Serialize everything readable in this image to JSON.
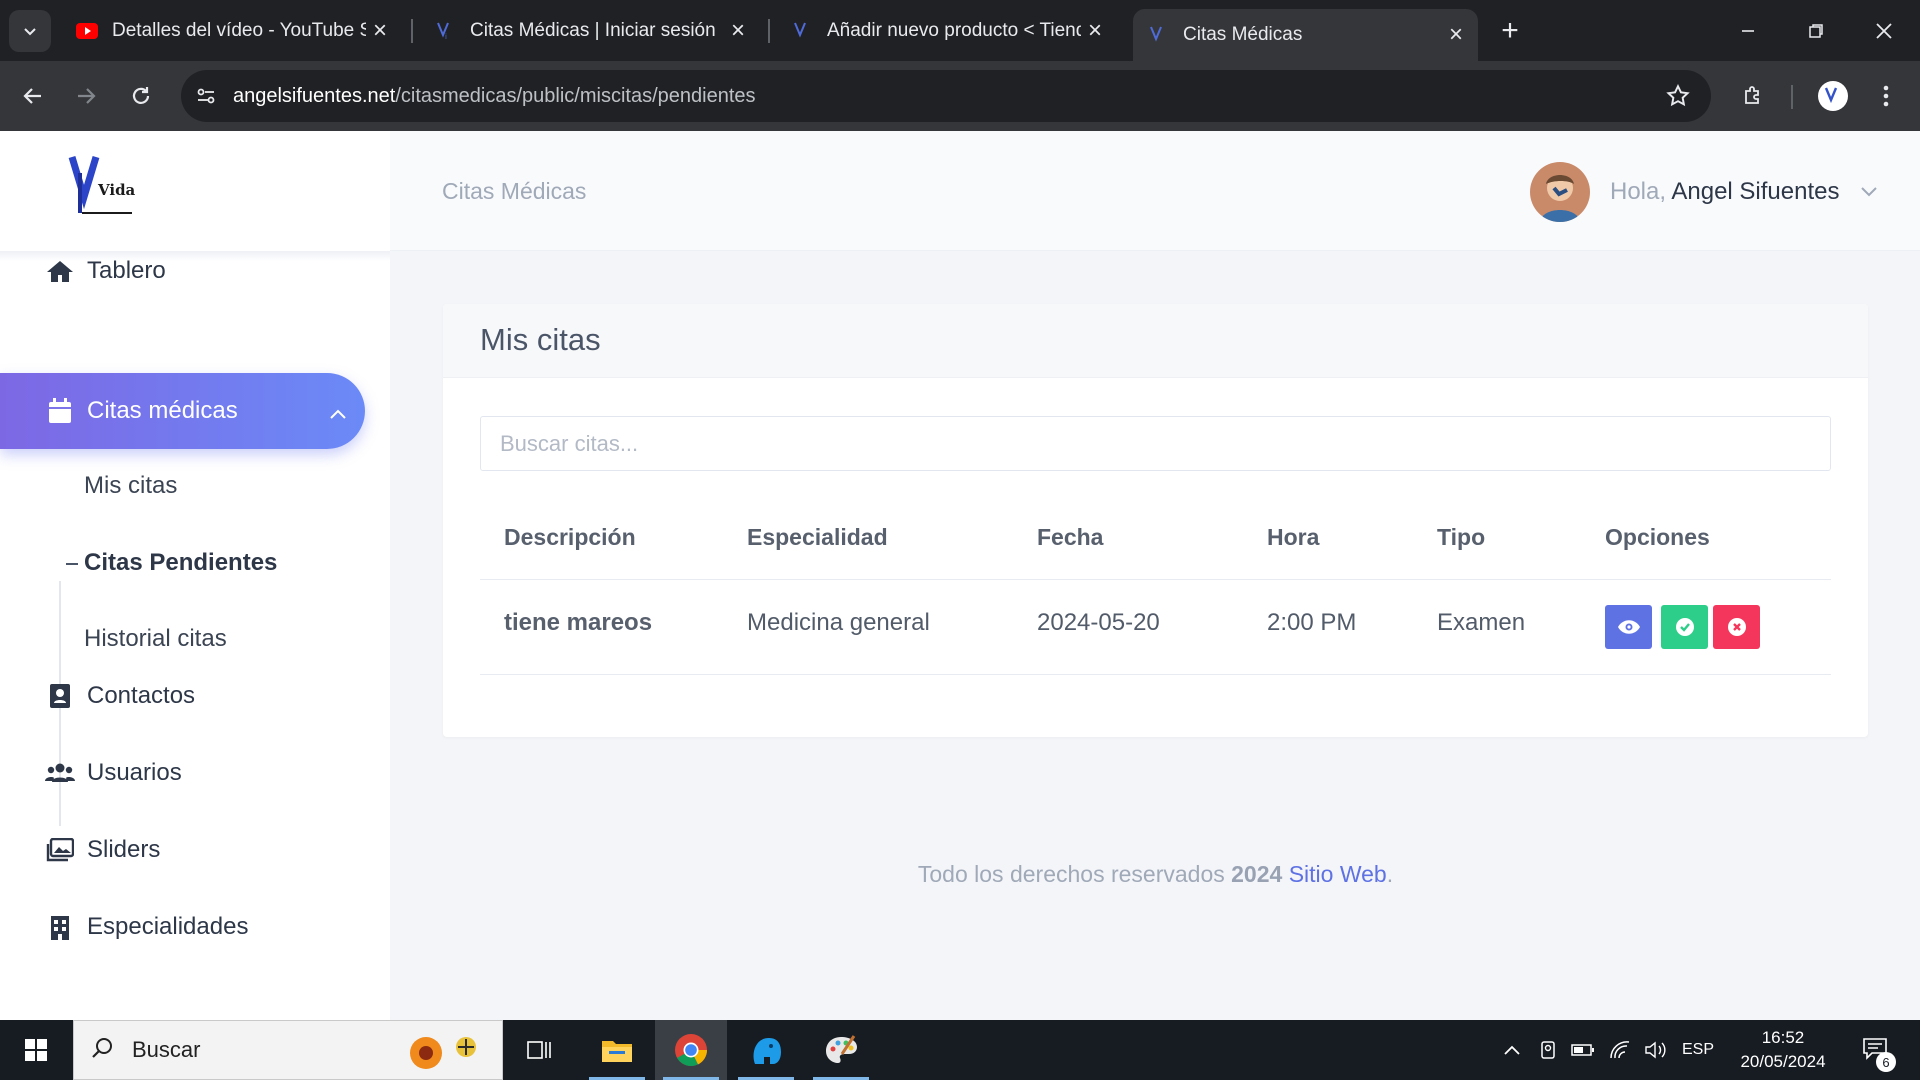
{
  "browser": {
    "tabs": [
      {
        "label": "Detalles del vídeo - YouTube St",
        "active": false
      },
      {
        "label": "Citas Médicas | Iniciar sesión",
        "active": false
      },
      {
        "label": "Añadir nuevo producto < Tiend",
        "active": false
      },
      {
        "label": "Citas Médicas",
        "active": true
      }
    ],
    "url_host": "angelsifuentes.net",
    "url_path": "/citasmedicas/public/miscitas/pendientes"
  },
  "app": {
    "title": "Citas Médicas",
    "logo_text": "Vida",
    "greeting": "Hola,",
    "user_name": "Angel Sifuentes"
  },
  "sidebar": {
    "items": [
      {
        "label": "Tablero",
        "icon": "home-icon"
      },
      {
        "label": "Citas médicas",
        "icon": "calendar-icon"
      },
      {
        "label": "Contactos",
        "icon": "contact-icon"
      },
      {
        "label": "Usuarios",
        "icon": "users-icon"
      },
      {
        "label": "Sliders",
        "icon": "images-icon"
      },
      {
        "label": "Especialidades",
        "icon": "building-icon"
      }
    ],
    "submenu": [
      {
        "label": "Mis citas"
      },
      {
        "label": "Citas Pendientes"
      },
      {
        "label": "Historial citas"
      }
    ]
  },
  "main": {
    "card_title": "Mis citas",
    "search_placeholder": "Buscar citas...",
    "columns": [
      "Descripción",
      "Especialidad",
      "Fecha",
      "Hora",
      "Tipo",
      "Opciones"
    ],
    "rows": [
      {
        "descripcion": "tiene mareos",
        "especialidad": "Medicina general",
        "fecha": "2024-05-20",
        "hora": "2:00 PM",
        "tipo": "Examen"
      }
    ],
    "action_colors": {
      "view": "#5e72e4",
      "accept": "#2dce89",
      "cancel": "#f5365c"
    }
  },
  "footer": {
    "text": "Todo los derechos reservados",
    "year": "2024",
    "site": "Sitio Web",
    "period": "."
  },
  "taskbar": {
    "search_label": "Buscar",
    "language": "ESP",
    "time": "16:52",
    "date": "20/05/2024",
    "notifications": "6"
  }
}
